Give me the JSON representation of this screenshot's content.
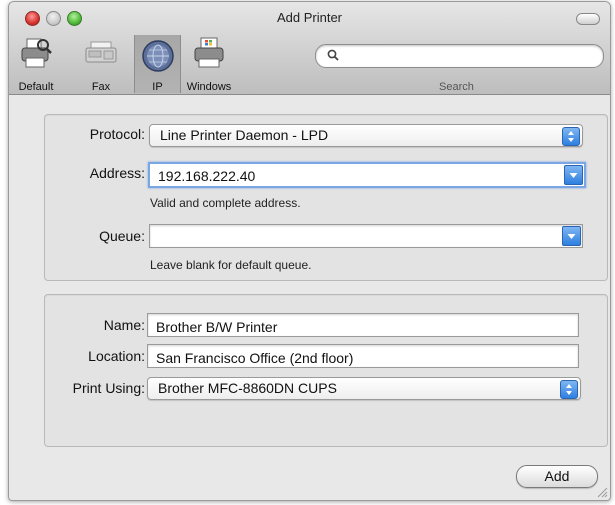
{
  "window": {
    "title": "Add Printer"
  },
  "toolbar": {
    "items": [
      {
        "label": "Default",
        "icon": "printer-default-icon"
      },
      {
        "label": "Fax",
        "icon": "fax-icon"
      },
      {
        "label": "IP",
        "icon": "globe-icon",
        "selected": true
      },
      {
        "label": "Windows",
        "icon": "windows-printer-icon"
      }
    ],
    "search": {
      "value": "",
      "label": "Search"
    }
  },
  "connection": {
    "protocol_label": "Protocol:",
    "protocol_value": "Line Printer Daemon - LPD",
    "address_label": "Address:",
    "address_value": "192.168.222.40",
    "address_hint": "Valid and complete address.",
    "queue_label": "Queue:",
    "queue_value": "",
    "queue_hint": "Leave blank for default queue."
  },
  "details": {
    "name_label": "Name:",
    "name_value": "Brother B/W Printer",
    "location_label": "Location:",
    "location_value": "San Francisco Office (2nd floor)",
    "print_using_label": "Print Using:",
    "print_using_value": "Brother MFC-8860DN CUPS"
  },
  "actions": {
    "add_label": "Add"
  },
  "colors": {
    "accent": "#2e7fe0",
    "focus_ring": "#7aa7e3",
    "window_bg": "#e8e8e8"
  }
}
